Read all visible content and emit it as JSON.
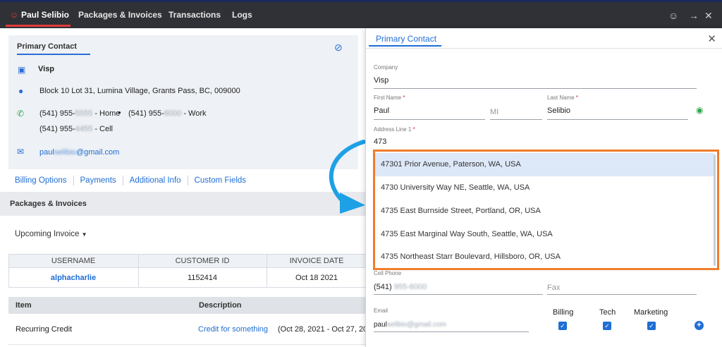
{
  "topbar": {
    "tabs": [
      {
        "label": "Paul Selibio"
      },
      {
        "label": "Packages & Invoices"
      },
      {
        "label": "Transactions"
      },
      {
        "label": "Logs"
      }
    ],
    "icons": [
      "smiley-icon",
      "forward-arrow-icon",
      "close-icon"
    ]
  },
  "contact": {
    "section_title": "Primary Contact",
    "company": "Visp",
    "address": "Block 10 Lot 31, Lumina Village, Grants Pass, BC, 009000",
    "phone_home": "(541) 955-",
    "phone_home_blur": "5555",
    "phone_home_suffix": "- Home",
    "phone_work": "(541) 955-",
    "phone_work_blur": "6000",
    "phone_work_suffix": "- Work",
    "phone_cell": "(541) 955-",
    "phone_cell_blur": "4455",
    "phone_cell_suffix": "- Cell",
    "email_prefix": "paul",
    "email_blur": "selibio",
    "email_suffix": "@gmail.com"
  },
  "links": [
    "Billing Options",
    "Payments",
    "Additional Info",
    "Custom Fields"
  ],
  "packages": {
    "title": "Packages & Invoices",
    "upcoming": "Upcoming Invoice",
    "columns": [
      "USERNAME",
      "CUSTOMER ID",
      "INVOICE DATE"
    ],
    "row": {
      "username": "alphacharlie",
      "customer_id": "1152414",
      "invoice_date": "Oct 18 2021"
    }
  },
  "items": {
    "columns": [
      "Item",
      "Description"
    ],
    "row": {
      "item": "Recurring Credit",
      "description": "Credit for something",
      "period": "(Oct 28, 2021 - Oct 27, 20"
    }
  },
  "panel": {
    "tab": "Primary Contact",
    "company_label": "Company",
    "company_value": "Visp",
    "first_name_label": "First Name",
    "first_name_value": "Paul",
    "mi_placeholder": "MI",
    "last_name_label": "Last Name",
    "last_name_value": "Selibio",
    "address1_label": "Address Line 1",
    "address1_value": "473",
    "cell_phone_label": "Cell Phone",
    "cell_phone_prefix": "(541)",
    "cell_phone_blur": "955-6000",
    "fax_placeholder": "Fax",
    "email_label": "Email",
    "email_prefix": "paul",
    "email_blur": "selibio@gmail.com",
    "checks": [
      "Billing",
      "Tech",
      "Marketing"
    ]
  },
  "suggestions": [
    "47301 Prior Avenue, Paterson, WA, USA",
    "4730 University Way NE, Seattle, WA, USA",
    "4735 East Burnside Street, Portland, OR, USA",
    "4735 East Marginal Way South, Seattle, WA, USA",
    "4735 Northeast Starr Boulevard, Hillsboro, OR, USA"
  ],
  "colors": {
    "accent": "#1f6ed4",
    "highlight_border": "#ef7d2c",
    "callout_arrow": "#1ea0e6"
  }
}
